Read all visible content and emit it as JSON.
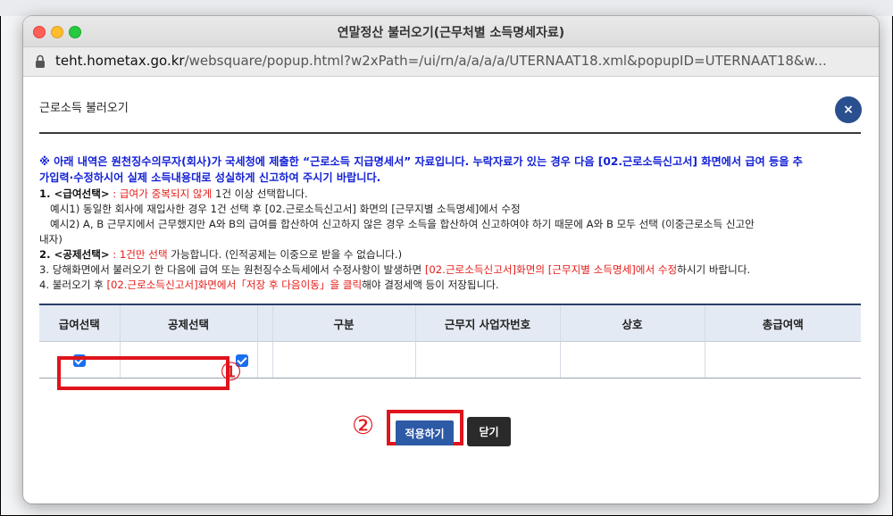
{
  "window": {
    "title": "연말정산 불러오기(근무처별 소득명세자료)",
    "url_host": "teht.hometax.go.kr",
    "url_path": "/websquare/popup.html?w2xPath=/ui/rn/a/a/a/a/UTERNAAT18.xml&popupID=UTERNAAT18&w..."
  },
  "page": {
    "title": "근로소득 불러오기",
    "close_icon": "×",
    "notice_line1": "※ 아래 내역은 원천징수의무자(회사)가 국세청에 제출한 “근로소득 지급명세서” 자료입니다. 누락자료가 있는 경우 다음 [02.근로소득신고서] 화면에서 급여 등을 추",
    "notice_line2": "가입력·수정하시어 실제 소득내용대로 성실하게 신고하여 주시기 바랍니다."
  },
  "info": {
    "item1_label": "1. <급여선택>",
    "item1_red": " : 급여가 중복되지 않게",
    "item1_rest": " 1건 이상 선택합니다.",
    "ex1": "예시1) 동일한 회사에 재입사한 경우 1건 선택 후 [02.근로소득신고서] 화면의 [근무지별 소득명세]에서 수정",
    "ex2_line1": "예시2) A, B 근무지에서 근무했지만 A와 B의 급여를 합산하여 신고하지 않은 경우 소득을 합산하여 신고하여야 하기 때문에 A와 B 모두 선택 (이중근로소득 신고안",
    "ex2_line2": "내자)",
    "item2_label": "2. <공제선택>",
    "item2_red": " : 1건만 선택",
    "item2_rest": " 가능합니다. (인적공제는 이중으로 받을 수 없습니다.)",
    "item3_a": "3. 당해화면에서 불러오기 한 다음에 급여 또는 원천징수소득세에서 수정사항이 발생하면 ",
    "item3_red": "[02.근로소득신고서]화면의 [근무지별 소득명세]에서 수정",
    "item3_b": "하시기 바랍니다.",
    "item4_a": "4. 불러오기 후 ",
    "item4_red": "[02.근로소득신고서]화면에서「저장 후 다음이동」을 클릭",
    "item4_b": "해야 결정세액 등이 저장됩니다."
  },
  "table": {
    "headers": [
      "급여선택",
      "공제선택",
      "",
      "구분",
      "근무지 사업자번호",
      "상호",
      "총급여액"
    ],
    "row": {
      "pay_checked": true,
      "deduct_checked": true,
      "category": "",
      "biz_no": "",
      "company": "",
      "total_pay": ""
    }
  },
  "annotations": {
    "marker1": "①",
    "marker2": "②"
  },
  "buttons": {
    "apply": "적용하기",
    "close": "닫기"
  },
  "colors": {
    "notice_blue": "#1422d6",
    "emphasis_red": "#e41b17",
    "annotation_red": "#e0141c",
    "apply_button": "#2d5aa5",
    "close_button": "#2a2a2a",
    "header_bg": "#e4eaf3"
  }
}
